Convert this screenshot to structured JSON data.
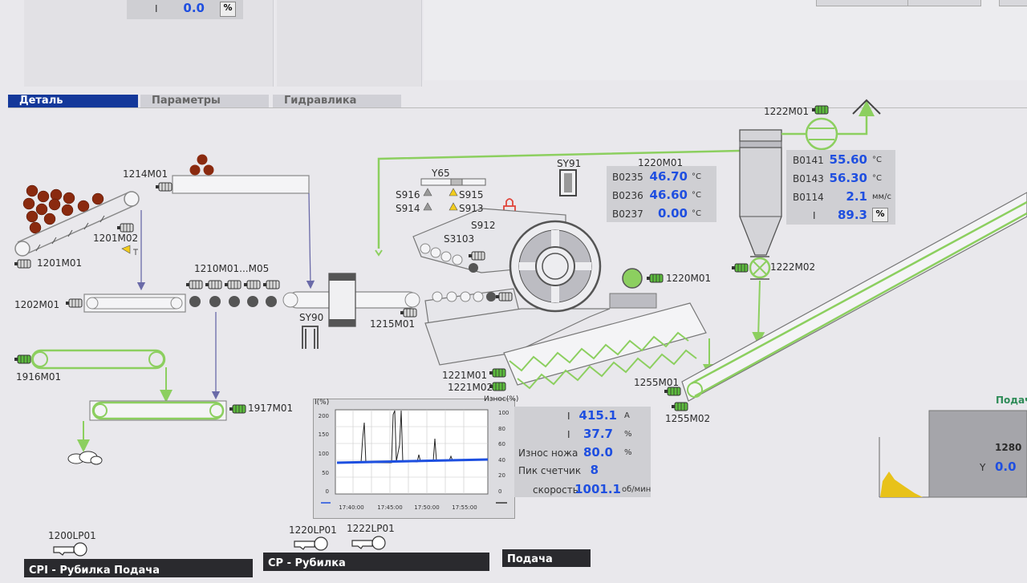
{
  "top": {
    "i_label": "I",
    "i_value": "0.0",
    "i_unit": "%"
  },
  "tabs": [
    {
      "label": "Деталь",
      "active": true
    },
    {
      "label": "Параметры",
      "active": false
    },
    {
      "label": "Гидравлика",
      "active": false
    }
  ],
  "labels": {
    "m1214": "1214M01",
    "m1201m02": "1201M02",
    "m1201m01": "1201M01",
    "m1202": "1202M01",
    "m1210": "1210M01...M05",
    "sy90": "SY90",
    "m1215": "1215M01",
    "m1916": "1916M01",
    "m1917": "1917M01",
    "y65": "Y65",
    "s916": "S916",
    "s915": "S915",
    "s914": "S914",
    "s913": "S913",
    "s912": "S912",
    "s3103": "S3103",
    "sy91": "SY91",
    "m1220top": "1220M01",
    "m1220": "1220M01",
    "m1221m01": "1221M01",
    "m1221m02": "1221M02",
    "m1222m01": "1222M01",
    "m1222m02": "1222M02",
    "m1255m01": "1255M01",
    "m1255m02": "1255M02",
    "lp1200": "1200LP01",
    "lp1220": "1220LP01",
    "lp1222": "1222LP01"
  },
  "readings_1220": [
    {
      "tag": "B0235",
      "value": "46.70",
      "unit": "°C"
    },
    {
      "tag": "B0236",
      "value": "46.60",
      "unit": "°C"
    },
    {
      "tag": "B0237",
      "value": "0.00",
      "unit": "°C"
    }
  ],
  "readings_1222": [
    {
      "tag": "B0141",
      "value": "55.60",
      "unit": "°C"
    },
    {
      "tag": "B0143",
      "value": "56.30",
      "unit": "°C"
    },
    {
      "tag": "B0114",
      "value": "2.1",
      "unit": "мм/с"
    },
    {
      "tag": "I",
      "value": "89.3",
      "unit": "%"
    }
  ],
  "chipper": [
    {
      "label": "I",
      "value": "415.1",
      "unit": "A"
    },
    {
      "label": "I",
      "value": "37.7",
      "unit": "%"
    },
    {
      "label": "Износ ножа",
      "value": "80.0",
      "unit": "%"
    },
    {
      "label": "Пик счетчик",
      "value": "8",
      "unit": ""
    },
    {
      "label": "скорость",
      "value": "1001.1",
      "unit": "об/мин"
    }
  ],
  "trend": {
    "left_title": "I(%)",
    "right_title": "Износ(%)",
    "left_ticks": [
      "200",
      "150",
      "100",
      "50",
      "0"
    ],
    "right_ticks": [
      "100",
      "80",
      "60",
      "40",
      "20",
      "0"
    ],
    "time_ticks": [
      "17:40:00",
      "17:45:00",
      "17:50:00",
      "17:55:00"
    ]
  },
  "right_panel": {
    "title": "Подача",
    "value_label": "1280",
    "y_label": "Y",
    "y_value": "0.0"
  },
  "bottom": {
    "cpi": "CPI - Рубилка Подача",
    "cp": "CP - Рубилка",
    "feed": "Подача"
  },
  "colors": {
    "accent_blue": "#14389a",
    "value_blue": "#1f4fe0",
    "pipe_green": "#8ccf5f",
    "motor_green": "#5cbb3d",
    "log_brown": "#8a2a0f",
    "warn_yellow": "#f2cc1d",
    "lock_red": "#e0453a"
  }
}
